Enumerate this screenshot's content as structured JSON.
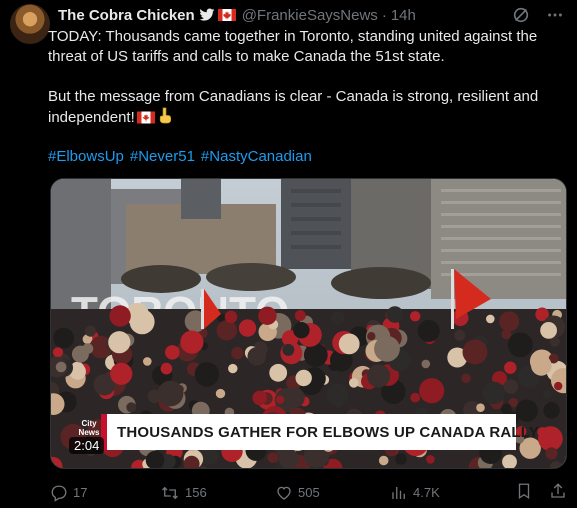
{
  "author": {
    "display_name": "The Cobra Chicken",
    "handle": "@FrankieSaysNews",
    "separator": "·",
    "time": "14h"
  },
  "tweet": {
    "line1": "TODAY:  Thousands came together in Toronto, standing united against the threat of US tariffs and calls to make Canada the 51st state.",
    "line2": "But the message from Canadians is clear - Canada is strong, resilient and independent!",
    "hashtags": [
      "#ElbowsUp",
      "#Never51",
      "#NastyCanadian"
    ]
  },
  "media": {
    "chyron": "THOUSANDS GATHER FOR ELBOWS UP CANADA RALLY",
    "logo_line1": "City",
    "logo_line2": "News",
    "duration": "2:04",
    "sign_text": "TORONTO"
  },
  "actions": {
    "replies": "17",
    "reposts": "156",
    "likes": "505",
    "views": "4.7K"
  },
  "icons": {
    "bird": "bird-icon",
    "flag": "canada-flag-icon",
    "grok": "grok-icon",
    "more": "more-icon",
    "reply": "reply-icon",
    "repost": "repost-icon",
    "like": "heart-icon",
    "views": "views-icon",
    "bookmark": "bookmark-icon",
    "share": "share-icon"
  },
  "colors": {
    "accent": "#1d9bf0",
    "muted": "#71767b",
    "text": "#e7e9ea",
    "canada_red": "#d52b1e"
  }
}
